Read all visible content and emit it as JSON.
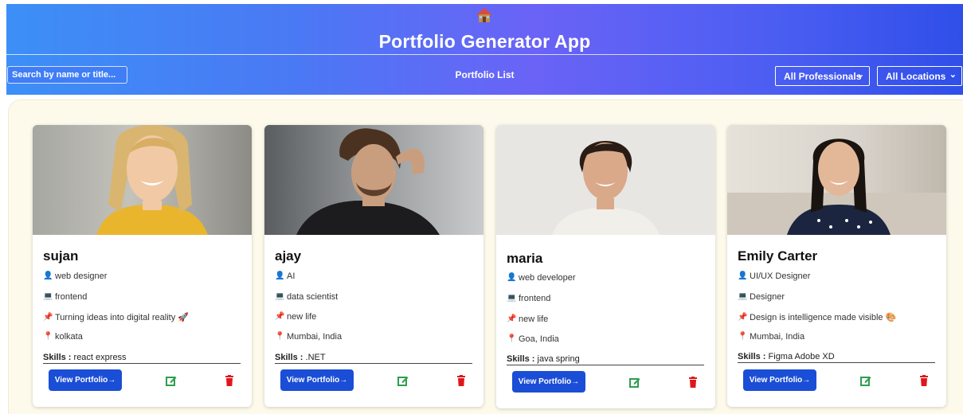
{
  "app": {
    "title": "Portfolio Generator App",
    "logo_icon": "house-icon"
  },
  "toolbar": {
    "search_placeholder": "Search by name or title...",
    "list_title": "Portfolio List",
    "professional_filter": "All Professionals",
    "location_filter": "All Locations"
  },
  "card_labels": {
    "skills_label": "Skills :",
    "view_button": "View Portfolio→"
  },
  "cards": [
    {
      "name": "sujan",
      "title": "web designer",
      "category": "frontend",
      "tagline": "Turning ideas into digital reality 🚀",
      "location": "kolkata",
      "skills": "react  express"
    },
    {
      "name": "ajay",
      "title": "AI",
      "category": "data scientist",
      "tagline": "new life",
      "location": "Mumbai, India",
      "skills": ".NET"
    },
    {
      "name": "maria",
      "title": "web developer",
      "category": "frontend",
      "tagline": "new life",
      "location": "Goa, India",
      "skills": "java  spring"
    },
    {
      "name": "Emily Carter",
      "title": "UI/UX Designer",
      "category": "Designer",
      "tagline": "Design is intelligence made visible 🎨",
      "location": "Mumbai, India",
      "skills": "Figma  Adobe XD"
    }
  ],
  "colors": {
    "header_start": "#3d8ff7",
    "header_end": "#2f4fe9",
    "panel_bg": "#fdfaeb",
    "button_blue": "#1b4ed6",
    "edit_green": "#2e9e4f",
    "delete_red": "#e0161b"
  }
}
